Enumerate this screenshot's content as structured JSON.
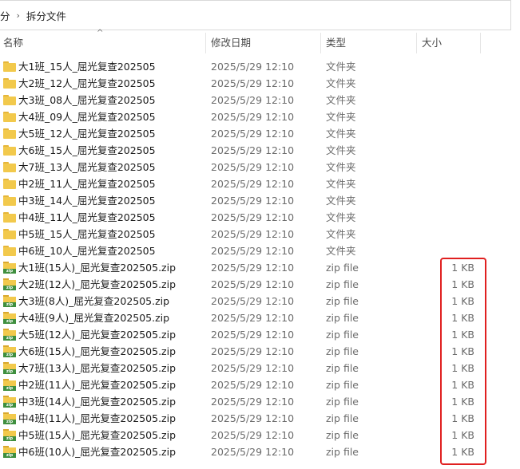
{
  "breadcrumb": {
    "parent": "分",
    "current": "拆分文件"
  },
  "columns": {
    "name": "名称",
    "date": "修改日期",
    "type": "类型",
    "size": "大小"
  },
  "folders": [
    {
      "name": "大1班_15人_屈光复查202505",
      "date": "2025/5/29 12:10",
      "type": "文件夹",
      "size": ""
    },
    {
      "name": "大2班_12人_屈光复查202505",
      "date": "2025/5/29 12:10",
      "type": "文件夹",
      "size": ""
    },
    {
      "name": "大3班_08人_屈光复查202505",
      "date": "2025/5/29 12:10",
      "type": "文件夹",
      "size": ""
    },
    {
      "name": "大4班_09人_屈光复查202505",
      "date": "2025/5/29 12:10",
      "type": "文件夹",
      "size": ""
    },
    {
      "name": "大5班_12人_屈光复查202505",
      "date": "2025/5/29 12:10",
      "type": "文件夹",
      "size": ""
    },
    {
      "name": "大6班_15人_屈光复查202505",
      "date": "2025/5/29 12:10",
      "type": "文件夹",
      "size": ""
    },
    {
      "name": "大7班_13人_屈光复查202505",
      "date": "2025/5/29 12:10",
      "type": "文件夹",
      "size": ""
    },
    {
      "name": "中2班_11人_屈光复查202505",
      "date": "2025/5/29 12:10",
      "type": "文件夹",
      "size": ""
    },
    {
      "name": "中3班_14人_屈光复查202505",
      "date": "2025/5/29 12:10",
      "type": "文件夹",
      "size": ""
    },
    {
      "name": "中4班_11人_屈光复查202505",
      "date": "2025/5/29 12:10",
      "type": "文件夹",
      "size": ""
    },
    {
      "name": "中5班_15人_屈光复查202505",
      "date": "2025/5/29 12:10",
      "type": "文件夹",
      "size": ""
    },
    {
      "name": "中6班_10人_屈光复查202505",
      "date": "2025/5/29 12:10",
      "type": "文件夹",
      "size": ""
    }
  ],
  "zips": [
    {
      "name": "大1班(15人)_屈光复查202505.zip",
      "date": "2025/5/29 12:10",
      "type": "zip file",
      "size": "1 KB"
    },
    {
      "name": "大2班(12人)_屈光复查202505.zip",
      "date": "2025/5/29 12:10",
      "type": "zip file",
      "size": "1 KB"
    },
    {
      "name": "大3班(8人)_屈光复查202505.zip",
      "date": "2025/5/29 12:10",
      "type": "zip file",
      "size": "1 KB"
    },
    {
      "name": "大4班(9人)_屈光复查202505.zip",
      "date": "2025/5/29 12:10",
      "type": "zip file",
      "size": "1 KB"
    },
    {
      "name": "大5班(12人)_屈光复查202505.zip",
      "date": "2025/5/29 12:10",
      "type": "zip file",
      "size": "1 KB"
    },
    {
      "name": "大6班(15人)_屈光复查202505.zip",
      "date": "2025/5/29 12:10",
      "type": "zip file",
      "size": "1 KB"
    },
    {
      "name": "大7班(13人)_屈光复查202505.zip",
      "date": "2025/5/29 12:10",
      "type": "zip file",
      "size": "1 KB"
    },
    {
      "name": "中2班(11人)_屈光复查202505.zip",
      "date": "2025/5/29 12:10",
      "type": "zip file",
      "size": "1 KB"
    },
    {
      "name": "中3班(14人)_屈光复查202505.zip",
      "date": "2025/5/29 12:10",
      "type": "zip file",
      "size": "1 KB"
    },
    {
      "name": "中4班(11人)_屈光复查202505.zip",
      "date": "2025/5/29 12:10",
      "type": "zip file",
      "size": "1 KB"
    },
    {
      "name": "中5班(15人)_屈光复查202505.zip",
      "date": "2025/5/29 12:10",
      "type": "zip file",
      "size": "1 KB"
    },
    {
      "name": "中6班(10人)_屈光复查202505.zip",
      "date": "2025/5/29 12:10",
      "type": "zip file",
      "size": "1 KB"
    }
  ],
  "icons": {
    "folder": "folder-icon",
    "zip": "zip-file-icon",
    "zip_label": "zip"
  },
  "colors": {
    "highlight": "#e02020",
    "folder": "#f2c94c",
    "zip_band": "#3f8f3f"
  }
}
